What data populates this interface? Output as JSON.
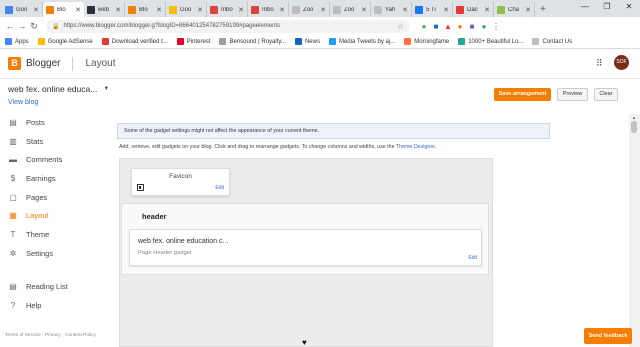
{
  "browser": {
    "tabs": [
      {
        "title": "Goo",
        "color": "#4285f4",
        "active": false
      },
      {
        "title": "Blo",
        "color": "#f57d00",
        "active": true
      },
      {
        "title": "web",
        "color": "#263238",
        "active": false
      },
      {
        "title": "Blo",
        "color": "#f57d00",
        "active": false
      },
      {
        "title": "Goo",
        "color": "#fbbc05",
        "active": false
      },
      {
        "title": "Inbo",
        "color": "#db4437",
        "active": false
      },
      {
        "title": "Inbo",
        "color": "#db4437",
        "active": false
      },
      {
        "title": "Zoo",
        "color": "#bdbdbd",
        "active": false
      },
      {
        "title": "Zoo",
        "color": "#bdbdbd",
        "active": false
      },
      {
        "title": "Yah",
        "color": "#bdbdbd",
        "active": false
      },
      {
        "title": "5 Ti",
        "color": "#1877f2",
        "active": false
      },
      {
        "title": "Dac",
        "color": "#e53935",
        "active": false
      },
      {
        "title": "Cha",
        "color": "#8bc34a",
        "active": false
      }
    ],
    "new_tab": "+",
    "address": "https://www.blogger.com/blogger.g?blogID=866401254782759199#pageelements",
    "bookmarks": [
      {
        "label": "Apps",
        "color": "#4285f4"
      },
      {
        "label": "Google AdSense",
        "color": "#fbbc05"
      },
      {
        "label": "Download verified t...",
        "color": "#e53935"
      },
      {
        "label": "Pinterest",
        "color": "#e60023"
      },
      {
        "label": "Bensound | Royalty...",
        "color": "#9e9e9e"
      },
      {
        "label": "News",
        "color": "#1565c0"
      },
      {
        "label": "Media Tweets by aj...",
        "color": "#1da1f2"
      },
      {
        "label": "Morningfame",
        "color": "#ff7043"
      },
      {
        "label": "1000+ Beautiful Lo...",
        "color": "#26a69a"
      },
      {
        "label": "Contact Us",
        "color": "#bdbdbd"
      }
    ]
  },
  "app": {
    "brand": "Blogger",
    "section": "Layout",
    "avatar_text": "SOF",
    "accent": "#f57d00"
  },
  "sidebar": {
    "blog_name": "web fex. online educa...",
    "view_blog": "View blog",
    "items": [
      {
        "label": "Posts",
        "icon": "posts-icon",
        "glyph": "▤",
        "active": false
      },
      {
        "label": "Stats",
        "icon": "stats-icon",
        "glyph": "▥",
        "active": false
      },
      {
        "label": "Comments",
        "icon": "comments-icon",
        "glyph": "▬",
        "active": false
      },
      {
        "label": "Earnings",
        "icon": "earnings-icon",
        "glyph": "$",
        "active": false
      },
      {
        "label": "Pages",
        "icon": "pages-icon",
        "glyph": "▢",
        "active": false
      },
      {
        "label": "Layout",
        "icon": "layout-icon",
        "glyph": "▦",
        "active": true
      },
      {
        "label": "Theme",
        "icon": "theme-icon",
        "glyph": "T",
        "active": false
      },
      {
        "label": "Settings",
        "icon": "settings-icon",
        "glyph": "✲",
        "active": false
      }
    ],
    "secondary": [
      {
        "label": "Reading List",
        "icon": "reading-list-icon",
        "glyph": "▤"
      },
      {
        "label": "Help",
        "icon": "help-icon",
        "glyph": "?"
      }
    ],
    "footer": "Terms of Service  ·  Privacy  ·  Content Policy"
  },
  "toolbar": {
    "save_label": "Save arrangement",
    "preview_label": "Preview",
    "clear_label": "Clear"
  },
  "main": {
    "notice": "Some of the gadget settings might not affect the appearance of your current theme.",
    "instructions": "Add, remove, edit gadgets on your blog. Click and drag to rearrange gadgets. To change columns and widths, use the ",
    "theme_designer": "Theme Designer",
    "favicon": {
      "title": "Favicon",
      "edit": "Edit"
    },
    "header_section": {
      "title": "header",
      "gadget_name": "web fex. online education c...",
      "gadget_type": "Page Header gadget",
      "edit": "Edit"
    }
  },
  "feedback": "Send feedback"
}
